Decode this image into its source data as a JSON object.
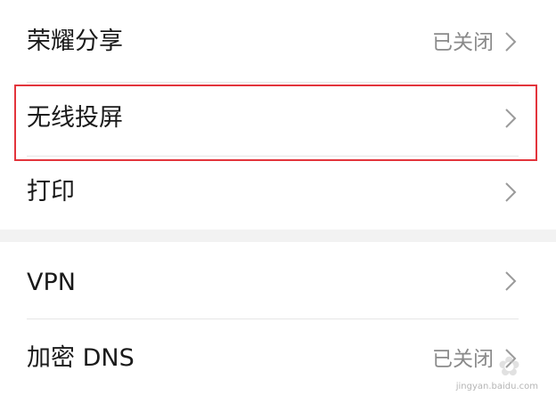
{
  "settings": {
    "items": [
      {
        "label": "荣耀分享",
        "value": "已关闭"
      },
      {
        "label": "无线投屏",
        "value": ""
      },
      {
        "label": "打印",
        "value": ""
      },
      {
        "label": "VPN",
        "value": ""
      },
      {
        "label": "加密 DNS",
        "value": "已关闭"
      }
    ]
  },
  "annotation": {
    "highlight_color": "#e3343c",
    "highlighted_item": "无线投屏"
  },
  "watermark": {
    "text": "jingyan.baidu.com"
  },
  "icons": {
    "chevron": "chevron-right-icon"
  }
}
